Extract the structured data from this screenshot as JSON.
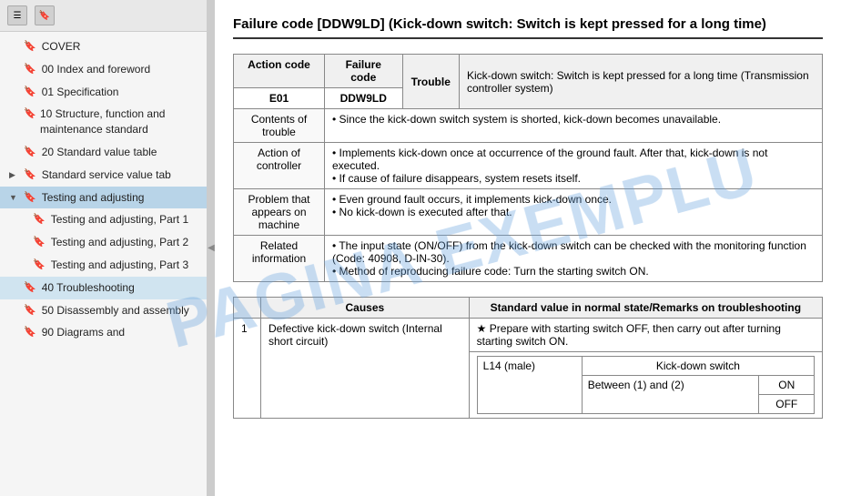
{
  "sidebar": {
    "toolbar": {
      "menu_icon": "☰",
      "bookmark_icon": "🔖"
    },
    "items": [
      {
        "id": "cover",
        "label": "COVER",
        "level": 0,
        "expandable": false
      },
      {
        "id": "00-index",
        "label": "00 Index and foreword",
        "level": 0,
        "expandable": false
      },
      {
        "id": "01-spec",
        "label": "01 Specification",
        "level": 0,
        "expandable": false
      },
      {
        "id": "10-structure",
        "label": "10 Structure, function and maintenance standard",
        "level": 0,
        "expandable": false
      },
      {
        "id": "20-standard",
        "label": "20 Standard value table",
        "level": 0,
        "expandable": false
      },
      {
        "id": "std-service",
        "label": "Standard service value tab",
        "level": 0,
        "expandable": true,
        "expanded": true
      },
      {
        "id": "testing-adj",
        "label": "Testing and adjusting",
        "level": 0,
        "expandable": true,
        "expanded": true,
        "highlighted": true
      },
      {
        "id": "testing-adj-1",
        "label": "Testing and adjusting, Part 1",
        "level": 1,
        "expandable": false
      },
      {
        "id": "testing-adj-2",
        "label": "Testing and adjusting, Part 2",
        "level": 1,
        "expandable": false
      },
      {
        "id": "testing-adj-3",
        "label": "Testing and adjusting, Part 3",
        "level": 1,
        "expandable": false
      },
      {
        "id": "40-trouble",
        "label": "40 Troubleshooting",
        "level": 0,
        "expandable": false,
        "active": true
      },
      {
        "id": "50-disassembly",
        "label": "50 Disassembly and assembly",
        "level": 0,
        "expandable": false
      },
      {
        "id": "90-diagrams",
        "label": "90 Diagrams and",
        "level": 0,
        "expandable": false
      }
    ]
  },
  "main": {
    "page_title": "Failure code [DDW9LD] (Kick-down switch: Switch is kept pressed for a long time)",
    "failure_table": {
      "headers": [
        "Action code",
        "Failure code",
        "Trouble",
        ""
      ],
      "action_code": "E01",
      "failure_code": "DDW9LD",
      "trouble": "Trouble",
      "trouble_desc": "Kick-down switch: Switch is kept pressed for a long time (Transmission controller system)",
      "rows": [
        {
          "header": "Contents of trouble",
          "content": "Since the kick-down switch system is shorted, kick-down becomes unavailable."
        },
        {
          "header": "Action of controller",
          "content": "• Implements kick-down once at occurrence of the ground fault. After that, kick-down is not executed.\n• If cause of failure disappears, system resets itself."
        },
        {
          "header": "Problem that appears on machine",
          "content": "• Even ground fault occurs, it implements kick-down once.\n• No kick-down is executed after that."
        },
        {
          "header": "Related information",
          "content": "• The input state (ON/OFF) from the kick-down switch can be checked with the monitoring function (Code: 40908, D-IN-30).\n• Method of reproducing failure code: Turn the starting switch ON."
        }
      ]
    },
    "causes_table": {
      "headers": [
        "",
        "Causes",
        "Standard value in normal state/Remarks on troubleshooting"
      ],
      "rows": [
        {
          "num": "1",
          "cause": "Defective kick-down switch (Internal short circuit)",
          "remedies": [
            {
              "label": "★ Prepare with starting switch OFF, then carry out after turning starting switch ON.",
              "sub": []
            },
            {
              "label": "L14 (male)",
              "sub_label": "Kick-down switch",
              "values": [
                {
                  "condition": "Between (1) and (2)",
                  "on": "ON",
                  "off": "OFF"
                }
              ]
            }
          ]
        }
      ]
    }
  },
  "watermark": "PAGINA EXEMPLU"
}
